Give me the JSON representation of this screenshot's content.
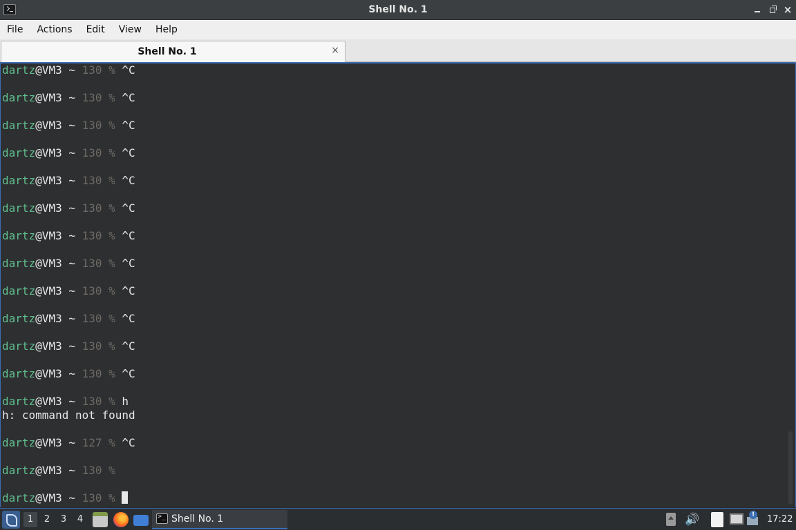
{
  "window": {
    "title": "Shell No. 1",
    "controls": {
      "minimize": "minimize",
      "maximize": "maximize",
      "close": "×"
    }
  },
  "menubar": {
    "items": [
      "File",
      "Actions",
      "Edit",
      "View",
      "Help"
    ]
  },
  "tabs": [
    {
      "label": "Shell No. 1",
      "close": "×"
    }
  ],
  "terminal": {
    "lines": [
      {
        "user": "dartz",
        "host": "@VM3 ~ ",
        "code": "130 %",
        "cmd": " ^C"
      },
      {
        "blank": true
      },
      {
        "user": "dartz",
        "host": "@VM3 ~ ",
        "code": "130 %",
        "cmd": " ^C"
      },
      {
        "blank": true
      },
      {
        "user": "dartz",
        "host": "@VM3 ~ ",
        "code": "130 %",
        "cmd": " ^C"
      },
      {
        "blank": true
      },
      {
        "user": "dartz",
        "host": "@VM3 ~ ",
        "code": "130 %",
        "cmd": " ^C"
      },
      {
        "blank": true
      },
      {
        "user": "dartz",
        "host": "@VM3 ~ ",
        "code": "130 %",
        "cmd": " ^C"
      },
      {
        "blank": true
      },
      {
        "user": "dartz",
        "host": "@VM3 ~ ",
        "code": "130 %",
        "cmd": " ^C"
      },
      {
        "blank": true
      },
      {
        "user": "dartz",
        "host": "@VM3 ~ ",
        "code": "130 %",
        "cmd": " ^C"
      },
      {
        "blank": true
      },
      {
        "user": "dartz",
        "host": "@VM3 ~ ",
        "code": "130 %",
        "cmd": " ^C"
      },
      {
        "blank": true
      },
      {
        "user": "dartz",
        "host": "@VM3 ~ ",
        "code": "130 %",
        "cmd": " ^C"
      },
      {
        "blank": true
      },
      {
        "user": "dartz",
        "host": "@VM3 ~ ",
        "code": "130 %",
        "cmd": " ^C"
      },
      {
        "blank": true
      },
      {
        "user": "dartz",
        "host": "@VM3 ~ ",
        "code": "130 %",
        "cmd": " ^C"
      },
      {
        "blank": true
      },
      {
        "user": "dartz",
        "host": "@VM3 ~ ",
        "code": "130 %",
        "cmd": " ^C"
      },
      {
        "blank": true
      },
      {
        "user": "dartz",
        "host": "@VM3 ~ ",
        "code": "130 %",
        "cmd": " h"
      },
      {
        "output": "h: command not found"
      },
      {
        "blank": true
      },
      {
        "user": "dartz",
        "host": "@VM3 ~ ",
        "code": "127 %",
        "cmd": " ^C"
      },
      {
        "blank": true
      },
      {
        "user": "dartz",
        "host": "@VM3 ~ ",
        "code": "130 %",
        "cmd": ""
      },
      {
        "blank": true
      },
      {
        "user": "dartz",
        "host": "@VM3 ~ ",
        "code": "130 %",
        "cmd": " ",
        "cursor": true
      }
    ]
  },
  "taskbar": {
    "workspaces": [
      "1",
      "2",
      "3",
      "4"
    ],
    "active_workspace": "1",
    "launchers": [
      "file-manager-icon",
      "firefox-icon",
      "show-desktop-icon"
    ],
    "task_label": "Shell No. 1",
    "clock": "17:22",
    "tray": [
      "tray-expand-icon",
      "volume-icon",
      "clipboard-icon",
      "network-icon",
      "notification-icon"
    ]
  },
  "colors": {
    "accent": "#3b6db3",
    "user": "#5fbf8f",
    "dim": "#6e6a66",
    "terminal_bg": "#2e2f30"
  }
}
